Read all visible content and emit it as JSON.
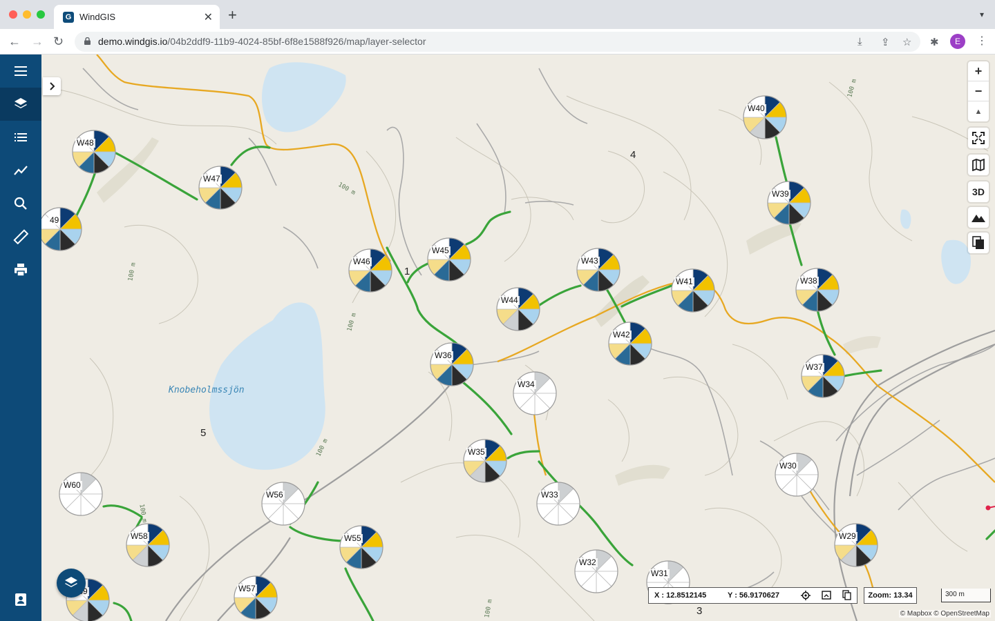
{
  "browser": {
    "tab_title": "WindGIS",
    "tab_favicon_letter": "G",
    "url_domain": "demo.windgis.io",
    "url_path": "/04b2ddf9-11b9-4024-85bf-6f8e1588f926/map/layer-selector",
    "profile_initial": "E"
  },
  "sidebar": {
    "items": [
      {
        "name": "menu-icon"
      },
      {
        "name": "layers-icon",
        "active": true
      },
      {
        "name": "list-icon"
      },
      {
        "name": "chart-icon"
      },
      {
        "name": "search-icon"
      },
      {
        "name": "ruler-icon"
      },
      {
        "name": "print-icon"
      },
      {
        "name": "contact-icon"
      }
    ]
  },
  "map": {
    "lake_label": "Knobeholmssjön",
    "area_numbers": [
      "4",
      "5",
      "1",
      "3"
    ],
    "contour_label": "100 m",
    "turbines": [
      {
        "id": "W48",
        "type": "full"
      },
      {
        "id": "W47",
        "type": "full"
      },
      {
        "id": "49",
        "type": "full"
      },
      {
        "id": "W46",
        "type": "full"
      },
      {
        "id": "W45",
        "type": "full"
      },
      {
        "id": "W44",
        "type": "partial"
      },
      {
        "id": "W43",
        "type": "full"
      },
      {
        "id": "W42",
        "type": "full"
      },
      {
        "id": "W41",
        "type": "full"
      },
      {
        "id": "W40",
        "type": "partial"
      },
      {
        "id": "W39",
        "type": "full"
      },
      {
        "id": "W38",
        "type": "full"
      },
      {
        "id": "W37",
        "type": "full"
      },
      {
        "id": "W36",
        "type": "full"
      },
      {
        "id": "W35",
        "type": "partial"
      },
      {
        "id": "W34",
        "type": "empty"
      },
      {
        "id": "W33",
        "type": "empty"
      },
      {
        "id": "W32",
        "type": "empty"
      },
      {
        "id": "W31",
        "type": "empty"
      },
      {
        "id": "W30",
        "type": "empty"
      },
      {
        "id": "W29",
        "type": "partial"
      },
      {
        "id": "W60",
        "type": "empty"
      },
      {
        "id": "W58",
        "type": "partial"
      },
      {
        "id": "W56",
        "type": "empty"
      },
      {
        "id": "W55",
        "type": "full"
      },
      {
        "id": "W57",
        "type": "full"
      },
      {
        "id": "W59",
        "type": "partial"
      }
    ],
    "colors": {
      "navy": "#0d3b73",
      "yellow": "#f2c200",
      "light_blue": "#a9d3ee",
      "dark": "#2b2b2b",
      "steel": "#2a6a96",
      "pale_yellow": "#f5dd8a",
      "grey": "#cdd0d2",
      "white": "#ffffff",
      "route_green": "#3aa43a",
      "road_orange": "#e7a822",
      "water": "#cfe4f2"
    }
  },
  "controls": {
    "zoom_in": "+",
    "zoom_out": "−",
    "compass": "▲",
    "three_d": "3D"
  },
  "status": {
    "x_coord": "X : 12.8512145",
    "y_coord": "Y : 56.9170627",
    "zoom": "Zoom: 13.34",
    "scale": "300 m",
    "attribution": "© Mapbox © OpenStreetMap"
  }
}
